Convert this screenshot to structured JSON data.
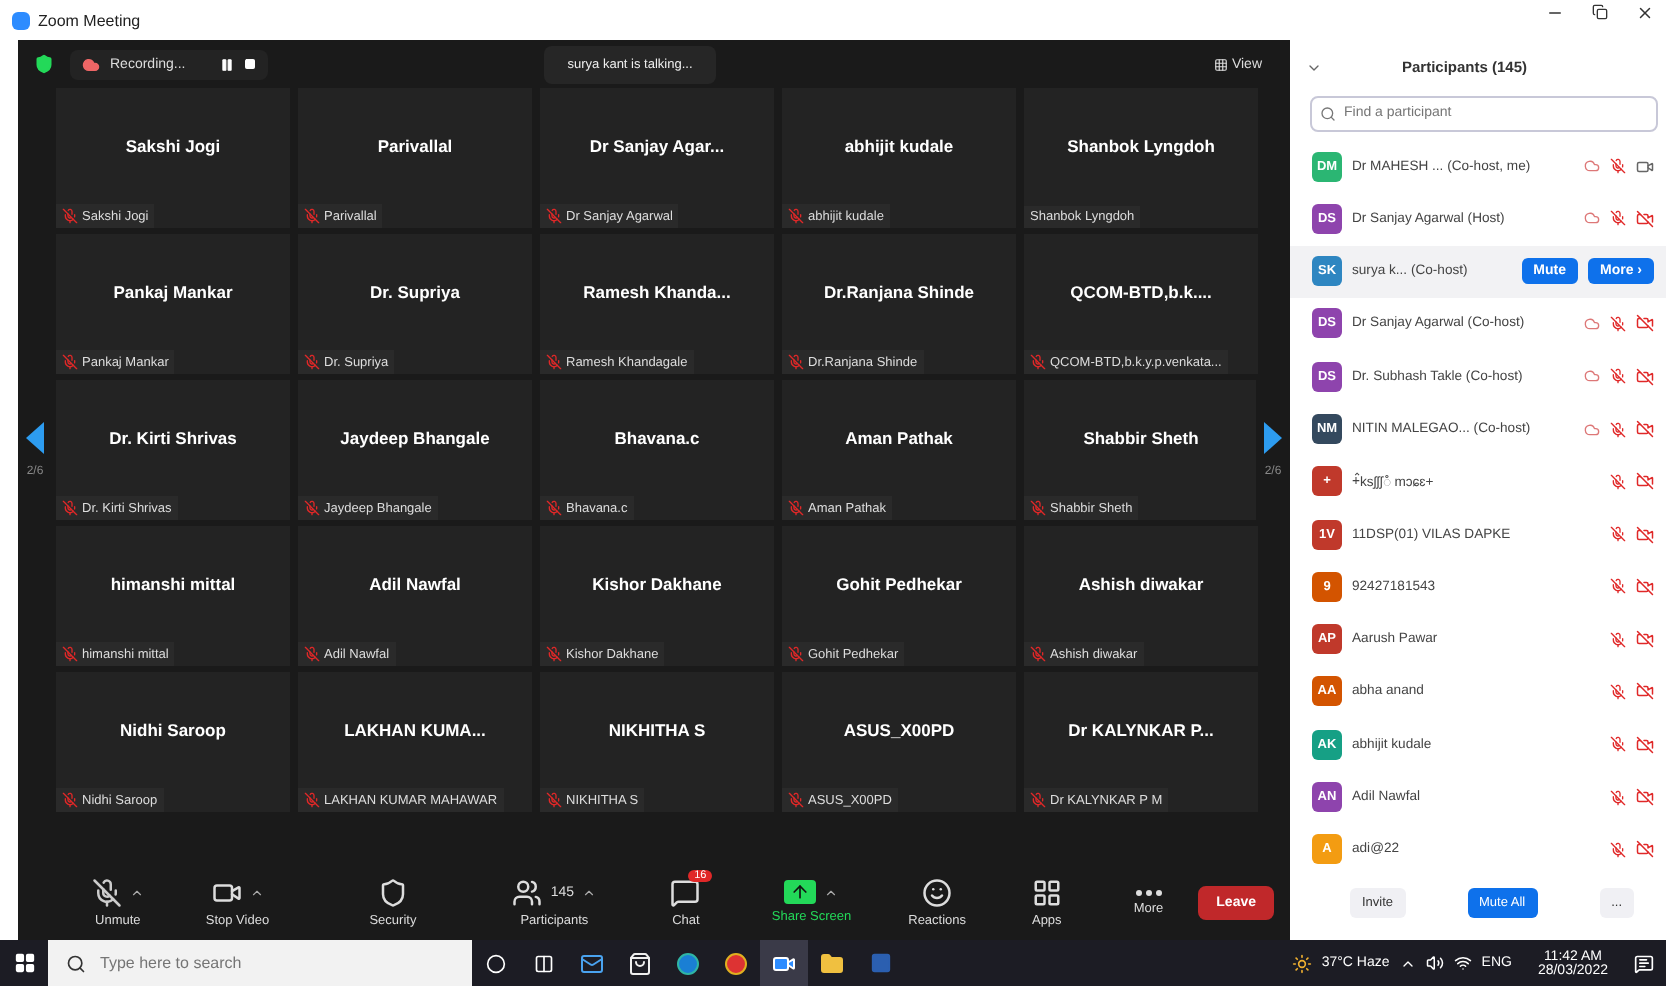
{
  "window": {
    "title": "Zoom Meeting"
  },
  "meeting_bar": {
    "recording": "Recording...",
    "talking": "surya kant is talking...",
    "view": "View"
  },
  "pager": {
    "left": "2/6",
    "right": "2/6"
  },
  "tiles": [
    {
      "name": "Sakshi Jogi",
      "label": "Sakshi Jogi",
      "muted": true
    },
    {
      "name": "Parivallal",
      "label": "Parivallal",
      "muted": true
    },
    {
      "name": "Dr Sanjay  Agar...",
      "label": "Dr Sanjay Agarwal",
      "muted": true
    },
    {
      "name": "abhijit kudale",
      "label": "abhijit kudale",
      "muted": true
    },
    {
      "name": "Shanbok Lyngdoh",
      "label": "Shanbok Lyngdoh",
      "muted": false
    },
    {
      "name": "Pankaj Mankar",
      "label": "Pankaj Mankar",
      "muted": true
    },
    {
      "name": "Dr. Supriya",
      "label": "Dr. Supriya",
      "muted": true
    },
    {
      "name": "Ramesh  Khanda...",
      "label": "Ramesh Khandagale",
      "muted": true
    },
    {
      "name": "Dr.Ranjana Shinde",
      "label": "Dr.Ranjana Shinde",
      "muted": true
    },
    {
      "name": "QCOM-BTD,b.k....",
      "label": "QCOM-BTD,b.k.y.p.venkata...",
      "muted": true
    },
    {
      "name": "Dr. Kirti Shrivas",
      "label": "Dr. Kirti Shrivas",
      "muted": true
    },
    {
      "name": "Jaydeep Bhangale",
      "label": "Jaydeep Bhangale",
      "muted": true
    },
    {
      "name": "Bhavana.c",
      "label": "Bhavana.c",
      "muted": true
    },
    {
      "name": "Aman Pathak",
      "label": "Aman Pathak",
      "muted": true
    },
    {
      "name": "Shabbir Sheth",
      "label": "Shabbir Sheth",
      "muted": true
    },
    {
      "name": "himanshi mittal",
      "label": "himanshi mittal",
      "muted": true
    },
    {
      "name": "Adil Nawfal",
      "label": "Adil Nawfal",
      "muted": true
    },
    {
      "name": "Kishor Dakhane",
      "label": "Kishor Dakhane",
      "muted": true
    },
    {
      "name": "Gohit Pedhekar",
      "label": "Gohit Pedhekar",
      "muted": true
    },
    {
      "name": "Ashish diwakar",
      "label": "Ashish diwakar",
      "muted": true
    },
    {
      "name": "Nidhi Saroop",
      "label": "Nidhi Saroop",
      "muted": true
    },
    {
      "name": "LAKHAN  KUMA...",
      "label": "LAKHAN KUMAR MAHAWAR",
      "muted": true
    },
    {
      "name": "NIKHITHA S",
      "label": "NIKHITHA S",
      "muted": true
    },
    {
      "name": "ASUS_X00PD",
      "label": "ASUS_X00PD",
      "muted": true
    },
    {
      "name": "Dr KALYNKAR P...",
      "label": "Dr KALYNKAR P M",
      "muted": true
    }
  ],
  "toolbar": [
    {
      "kind": "mic",
      "label": "Unmute",
      "caret": true
    },
    {
      "kind": "video",
      "label": "Stop Video",
      "caret": true
    },
    {
      "kind": "security",
      "label": "Security",
      "caret": false
    },
    {
      "kind": "participants",
      "label": "Participants",
      "count": "145",
      "caret": true
    },
    {
      "kind": "chat",
      "label": "Chat",
      "badge": "16",
      "caret": false
    },
    {
      "kind": "share",
      "label": "Share Screen",
      "caret": true
    },
    {
      "kind": "reactions",
      "label": "Reactions",
      "caret": false
    },
    {
      "kind": "apps",
      "label": "Apps",
      "caret": false
    },
    {
      "kind": "more",
      "label": "More",
      "caret": false
    }
  ],
  "leave": "Leave",
  "panel": {
    "title": "Participants (145)",
    "search": {
      "placeholder": "Find a participant"
    },
    "participants": [
      {
        "initials": "DM",
        "color": "#2bb673",
        "name": "Dr MAHESH ... (Co-host, me)",
        "cloud": true,
        "muted": true,
        "video": true,
        "selected": false
      },
      {
        "initials": "DS",
        "color": "#8e44ad",
        "name": "Dr Sanjay Agarwal (Host)",
        "cloud": true,
        "muted": true,
        "video": false,
        "selected": false
      },
      {
        "initials": "SK",
        "color": "#2e86c1",
        "name": "surya k... (Co-host)",
        "selected": true,
        "actions": [
          "Mute",
          "More ›"
        ]
      },
      {
        "initials": "DS",
        "color": "#8e44ad",
        "name": "Dr Sanjay Agarwal (Co-host)",
        "cloud": true,
        "muted": true,
        "video": false,
        "selected": false
      },
      {
        "initials": "DS",
        "color": "#8e44ad",
        "name": "Dr. Subhash Takle (Co-host)",
        "cloud": true,
        "muted": true,
        "video": false,
        "selected": false
      },
      {
        "initials": "NM",
        "color": "#34495e",
        "name": "NITIN MALEGAO... (Co-host)",
        "cloud": true,
        "muted": true,
        "video": false,
        "selected": false
      },
      {
        "initials": "+",
        "color": "#c0392b",
        "name": "+꠆ksʃʃʃꠋ mɔɕɛ+",
        "cloud": false,
        "muted": true,
        "video": false,
        "selected": false
      },
      {
        "initials": "1V",
        "color": "#c0392b",
        "name": "11DSP(01) VILAS DAPKE",
        "cloud": false,
        "muted": true,
        "video": false,
        "selected": false
      },
      {
        "initials": "9",
        "color": "#d35400",
        "name": "92427181543",
        "cloud": false,
        "muted": true,
        "video": false,
        "selected": false
      },
      {
        "initials": "AP",
        "color": "#c0392b",
        "name": "Aarush Pawar",
        "cloud": false,
        "muted": true,
        "video": false,
        "selected": false
      },
      {
        "initials": "AA",
        "color": "#d35400",
        "name": "abha anand",
        "cloud": false,
        "muted": true,
        "video": false,
        "selected": false
      },
      {
        "initials": "AK",
        "color": "#16a085",
        "name": "abhijit kudale",
        "cloud": false,
        "muted": true,
        "video": false,
        "selected": false
      },
      {
        "initials": "AN",
        "color": "#8e44ad",
        "name": "Adil Nawfal",
        "cloud": false,
        "muted": true,
        "video": false,
        "selected": false
      },
      {
        "initials": "A",
        "color": "#f39c12",
        "name": "adi@22",
        "cloud": false,
        "muted": true,
        "video": false,
        "selected": false
      }
    ],
    "buttons": {
      "invite": "Invite",
      "mute_all": "Mute All",
      "more": "..."
    }
  },
  "taskbar": {
    "search": {
      "placeholder": "Type here to search"
    },
    "weather": "37°C  Haze",
    "language": "ENG",
    "time": "11:42 AM",
    "date": "28/03/2022"
  }
}
